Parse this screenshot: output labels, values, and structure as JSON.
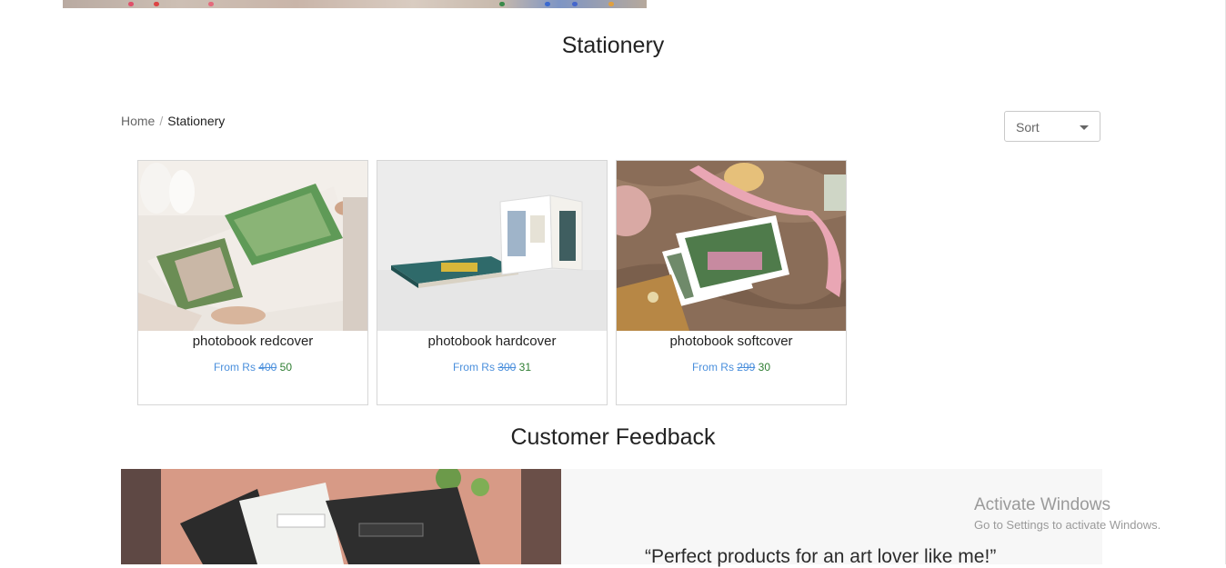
{
  "page": {
    "title": "Stationery"
  },
  "breadcrumb": {
    "home": "Home",
    "separator": "/",
    "current": "Stationery"
  },
  "sort": {
    "label": "Sort"
  },
  "products": [
    {
      "name": "photobook redcover",
      "price_prefix": "From Rs",
      "old_price": "400",
      "new_price": "50"
    },
    {
      "name": "photobook hardcover",
      "price_prefix": "From Rs",
      "old_price": "300",
      "new_price": "31"
    },
    {
      "name": "photobook softcover",
      "price_prefix": "From Rs",
      "old_price": "299",
      "new_price": "30"
    }
  ],
  "feedback": {
    "title": "Customer Feedback",
    "quote": "“Perfect products for an art lover like me!”"
  },
  "watermark": {
    "line1": "Activate Windows",
    "line2": "Go to Settings to activate Windows."
  },
  "colors": {
    "price_link": "#4a8fdc",
    "price_new": "#2e7d32",
    "panel_bg": "#f7f7f7"
  }
}
